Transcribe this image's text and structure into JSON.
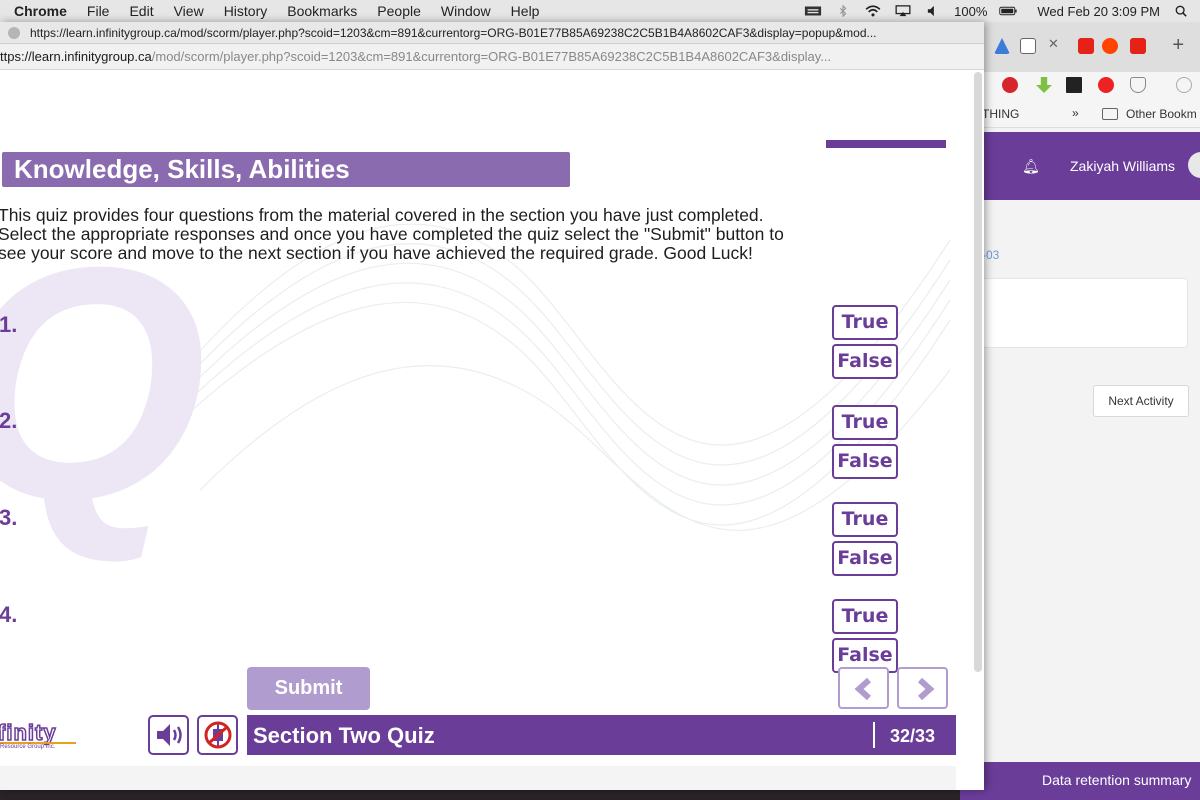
{
  "menubar": {
    "app": "Chrome",
    "items": [
      "File",
      "Edit",
      "View",
      "History",
      "Bookmarks",
      "People",
      "Window",
      "Help"
    ],
    "battery": "100%",
    "datetime": "Wed Feb 20  3:09 PM"
  },
  "popup": {
    "title_url": "https://learn.infinitygroup.ca/mod/scorm/player.php?scoid=1203&cm=891&currentorg=ORG-B01E77B85A69238C2C5B1B4A8602CAF3&display=popup&mod...",
    "url_host": "ttps://learn.infinitygroup.ca",
    "url_path": "/mod/scorm/player.php?scoid=1203&cm=891&currentorg=ORG-B01E77B85A69238C2C5B1B4A8602CAF3&display..."
  },
  "course": {
    "heading": "Knowledge, Skills, Abilities",
    "intro_lines": [
      "This quiz provides four questions from the material covered in the section you have just completed.",
      "Select the appropriate responses and once you have completed the quiz select the \"Submit\" button to",
      "see your score and move to the next section if you have achieved the required grade. Good Luck!"
    ],
    "questions": [
      "1.",
      "2.",
      "3.",
      "4."
    ],
    "true_label": "True",
    "false_label": "False",
    "submit_label": "Submit",
    "section_title": "Section Two Quiz",
    "page_indicator": "32/33",
    "logo_text": "finity",
    "logo_subtext": "Resource Group Inc."
  },
  "background_window": {
    "bookmark_partial": "THING",
    "bookmarks_chevron": "»",
    "other_bookmarks": "Other Bookm",
    "user_name": "Zakiyah Williams",
    "breadcrumb_partial": "-03",
    "next_activity": "Next Activity",
    "footer_link": "Data retention summary"
  },
  "colors": {
    "accent": "#6a3d99",
    "accent_light": "#8a6bb0",
    "submit_disabled": "#b09ccf"
  }
}
